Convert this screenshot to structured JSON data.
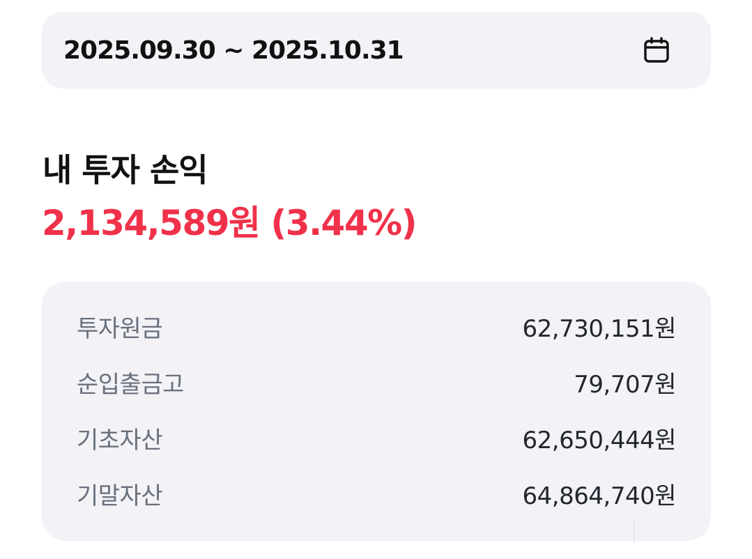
{
  "date_range": {
    "label": "2025.09.30 ~ 2025.10.31",
    "icon": "calendar-icon"
  },
  "summary": {
    "title": "내 투자 손익",
    "profit": "2,134,589원 (3.44%)",
    "profit_color": "#f0314a"
  },
  "details": {
    "rows": [
      {
        "label": "투자원금",
        "value": "62,730,151원"
      },
      {
        "label": "순입출금고",
        "value": "79,707원"
      },
      {
        "label": "기초자산",
        "value": "62,650,444원"
      },
      {
        "label": "기말자산",
        "value": "64,864,740원"
      }
    ]
  },
  "colors": {
    "card_background": "#f2f2f7",
    "label_text": "#69707c",
    "value_text": "#22262e"
  }
}
